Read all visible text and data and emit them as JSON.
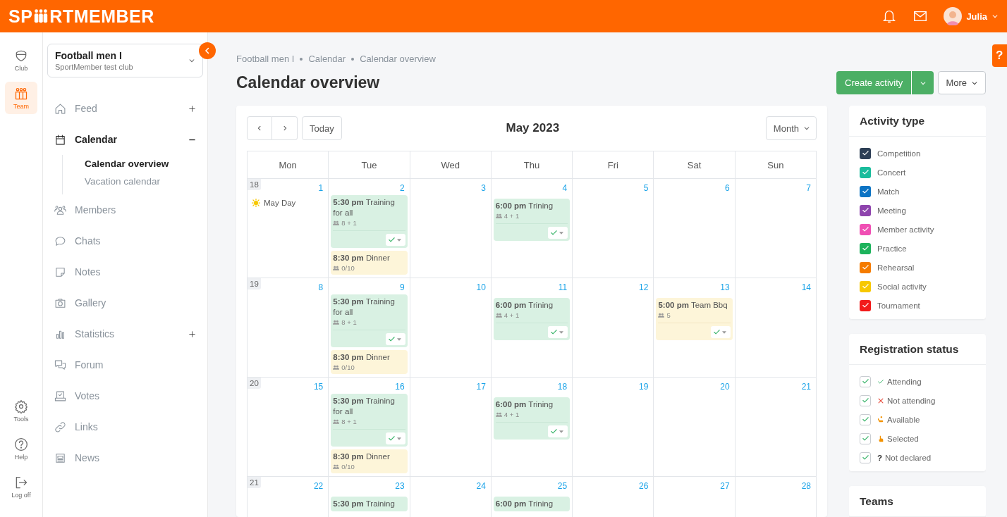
{
  "header": {
    "logo_start": "SP",
    "logo_end": "RTMEMBER",
    "user": "Julia"
  },
  "rail_top": [
    {
      "label": "Club",
      "selected": false
    },
    {
      "label": "Team",
      "selected": true
    }
  ],
  "rail_bottom": [
    {
      "label": "Tools",
      "selected": false
    },
    {
      "label": "Help",
      "selected": false
    },
    {
      "label": "Log off",
      "selected": false
    }
  ],
  "team_picker": {
    "name": "Football men I",
    "club": "SportMember test club"
  },
  "nav": [
    {
      "label": "Feed",
      "expanded": false,
      "selected": false
    },
    {
      "label": "Calendar",
      "expanded": true,
      "selected": true,
      "children": [
        {
          "label": "Calendar overview",
          "selected": true
        },
        {
          "label": "Vacation calendar",
          "selected": false
        }
      ]
    },
    {
      "label": "Members",
      "selected": false
    },
    {
      "label": "Chats",
      "selected": false
    },
    {
      "label": "Notes",
      "selected": false
    },
    {
      "label": "Gallery",
      "selected": false
    },
    {
      "label": "Statistics",
      "expanded": false,
      "selected": false
    },
    {
      "label": "Forum",
      "selected": false
    },
    {
      "label": "Votes",
      "selected": false
    },
    {
      "label": "Links",
      "selected": false
    },
    {
      "label": "News",
      "selected": false
    }
  ],
  "breadcrumb": [
    "Football men I",
    "Calendar",
    "Calendar overview"
  ],
  "page_title": "Calendar overview",
  "actions": {
    "primary": "Create activity",
    "more": "More"
  },
  "calendar": {
    "today_button": "Today",
    "month": "May 2023",
    "view": "Month",
    "weekdays": [
      "Mon",
      "Tue",
      "Wed",
      "Thu",
      "Fri",
      "Sat",
      "Sun"
    ],
    "weeks": [
      {
        "number": "18",
        "days": [
          {
            "date": "1",
            "holiday": "May Day"
          },
          {
            "date": "2",
            "events": [
              {
                "time": "5:30 pm",
                "title": "Training for all",
                "count": "8 + 1",
                "kind": "practice",
                "attending": true
              },
              {
                "time": "8:30 pm",
                "title": "Dinner",
                "count": "0/10",
                "kind": "social"
              }
            ]
          },
          {
            "date": "3"
          },
          {
            "date": "4",
            "events": [
              {
                "time": "6:00 pm",
                "title": "Trining",
                "count": "4 + 1",
                "kind": "practice",
                "attending": true
              }
            ]
          },
          {
            "date": "5"
          },
          {
            "date": "6"
          },
          {
            "date": "7"
          }
        ]
      },
      {
        "number": "19",
        "days": [
          {
            "date": "8"
          },
          {
            "date": "9",
            "events": [
              {
                "time": "5:30 pm",
                "title": "Training for all",
                "count": "8 + 1",
                "kind": "practice",
                "attending": true
              },
              {
                "time": "8:30 pm",
                "title": "Dinner",
                "count": "0/10",
                "kind": "social"
              }
            ]
          },
          {
            "date": "10"
          },
          {
            "date": "11",
            "events": [
              {
                "time": "6:00 pm",
                "title": "Trining",
                "count": "4 + 1",
                "kind": "practice",
                "attending": true
              }
            ]
          },
          {
            "date": "12"
          },
          {
            "date": "13",
            "events": [
              {
                "time": "5:00 pm",
                "title": "Team Bbq",
                "count": "5",
                "kind": "social",
                "attending": true
              }
            ]
          },
          {
            "date": "14"
          }
        ]
      },
      {
        "number": "20",
        "days": [
          {
            "date": "15"
          },
          {
            "date": "16",
            "events": [
              {
                "time": "5:30 pm",
                "title": "Training for all",
                "count": "8 + 1",
                "kind": "practice",
                "attending": true
              },
              {
                "time": "8:30 pm",
                "title": "Dinner",
                "count": "0/10",
                "kind": "social"
              }
            ]
          },
          {
            "date": "17"
          },
          {
            "date": "18",
            "events": [
              {
                "time": "6:00 pm",
                "title": "Trining",
                "count": "4 + 1",
                "kind": "practice",
                "attending": true
              }
            ]
          },
          {
            "date": "19"
          },
          {
            "date": "20"
          },
          {
            "date": "21"
          }
        ]
      },
      {
        "number": "21",
        "days": [
          {
            "date": "22"
          },
          {
            "date": "23",
            "events": [
              {
                "time": "5:30 pm",
                "title": "Training",
                "kind": "practice"
              }
            ]
          },
          {
            "date": "24"
          },
          {
            "date": "25",
            "events": [
              {
                "time": "6:00 pm",
                "title": "Trining",
                "kind": "practice"
              }
            ]
          },
          {
            "date": "26"
          },
          {
            "date": "27"
          },
          {
            "date": "28"
          }
        ]
      }
    ]
  },
  "activity_types": {
    "title": "Activity type",
    "items": [
      {
        "label": "Competition",
        "color": "#2c3e55",
        "checked": true
      },
      {
        "label": "Concert",
        "color": "#1abc9c",
        "checked": true
      },
      {
        "label": "Match",
        "color": "#0d74c4",
        "checked": true
      },
      {
        "label": "Meeting",
        "color": "#8e44ad",
        "checked": true
      },
      {
        "label": "Member activity",
        "color": "#f04fb4",
        "checked": true
      },
      {
        "label": "Practice",
        "color": "#1db35c",
        "checked": true
      },
      {
        "label": "Rehearsal",
        "color": "#f57c00",
        "checked": true
      },
      {
        "label": "Social activity",
        "color": "#f7c800",
        "checked": true
      },
      {
        "label": "Tournament",
        "color": "#f21a1a",
        "checked": true
      }
    ]
  },
  "registration_status": {
    "title": "Registration status",
    "items": [
      {
        "label": "Attending",
        "kind": "attending",
        "checked": true
      },
      {
        "label": "Not attending",
        "kind": "not_attending",
        "checked": true
      },
      {
        "label": "Available",
        "kind": "available",
        "checked": true
      },
      {
        "label": "Selected",
        "kind": "selected",
        "checked": true
      },
      {
        "label": "Not declared",
        "kind": "not_declared",
        "mark": "?",
        "checked": true
      }
    ]
  },
  "teams": {
    "title": "Teams"
  },
  "help_tab": "?"
}
